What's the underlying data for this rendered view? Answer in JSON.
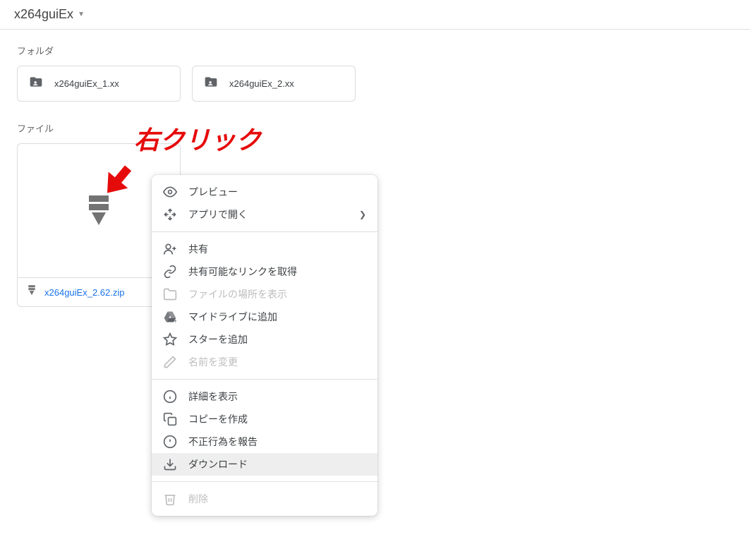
{
  "header": {
    "title": "x264guiEx"
  },
  "sections": {
    "folders_label": "フォルダ",
    "files_label": "ファイル"
  },
  "folders": [
    {
      "name": "x264guiEx_1.xx"
    },
    {
      "name": "x264guiEx_2.xx"
    }
  ],
  "files": [
    {
      "name": "x264guiEx_2.62.zip"
    }
  ],
  "annotation": {
    "text": "右クリック"
  },
  "context_menu": {
    "preview": "プレビュー",
    "open_with": "アプリで開く",
    "share": "共有",
    "get_link": "共有可能なリンクを取得",
    "show_location": "ファイルの場所を表示",
    "add_to_drive": "マイドライブに追加",
    "add_star": "スターを追加",
    "rename": "名前を変更",
    "show_details": "詳細を表示",
    "make_copy": "コピーを作成",
    "report_abuse": "不正行為を報告",
    "download": "ダウンロード",
    "delete": "削除"
  }
}
